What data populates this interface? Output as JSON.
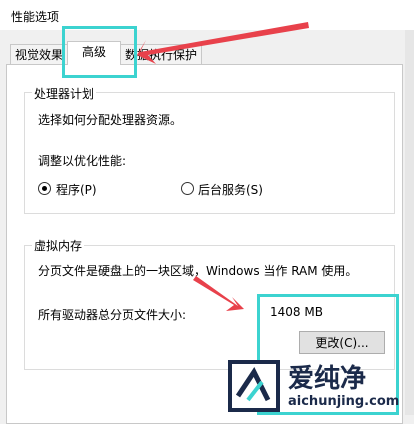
{
  "window": {
    "title": "性能选项"
  },
  "tabs": [
    {
      "label": "视觉效果"
    },
    {
      "label": "高级"
    },
    {
      "label": "数据执行保护"
    }
  ],
  "processor": {
    "title": "处理器计划",
    "description": "选择如何分配处理器资源。",
    "optimize_label": "调整以优化性能:",
    "option_programs": "程序(P)",
    "option_services": "后台服务(S)",
    "selected": "程序(P)"
  },
  "virtual_memory": {
    "title": "虚拟内存",
    "description": "分页文件是硬盘上的一块区域，Windows 当作 RAM 使用。",
    "total_label": "所有驱动器总分页文件大小:",
    "total_value": "1408 MB",
    "change_button": "更改(C)..."
  },
  "watermark": {
    "brand": "爱纯净",
    "url": "aichunjing.com"
  },
  "colors": {
    "highlight": "#3cd3d0",
    "arrow": "#e8414b"
  }
}
